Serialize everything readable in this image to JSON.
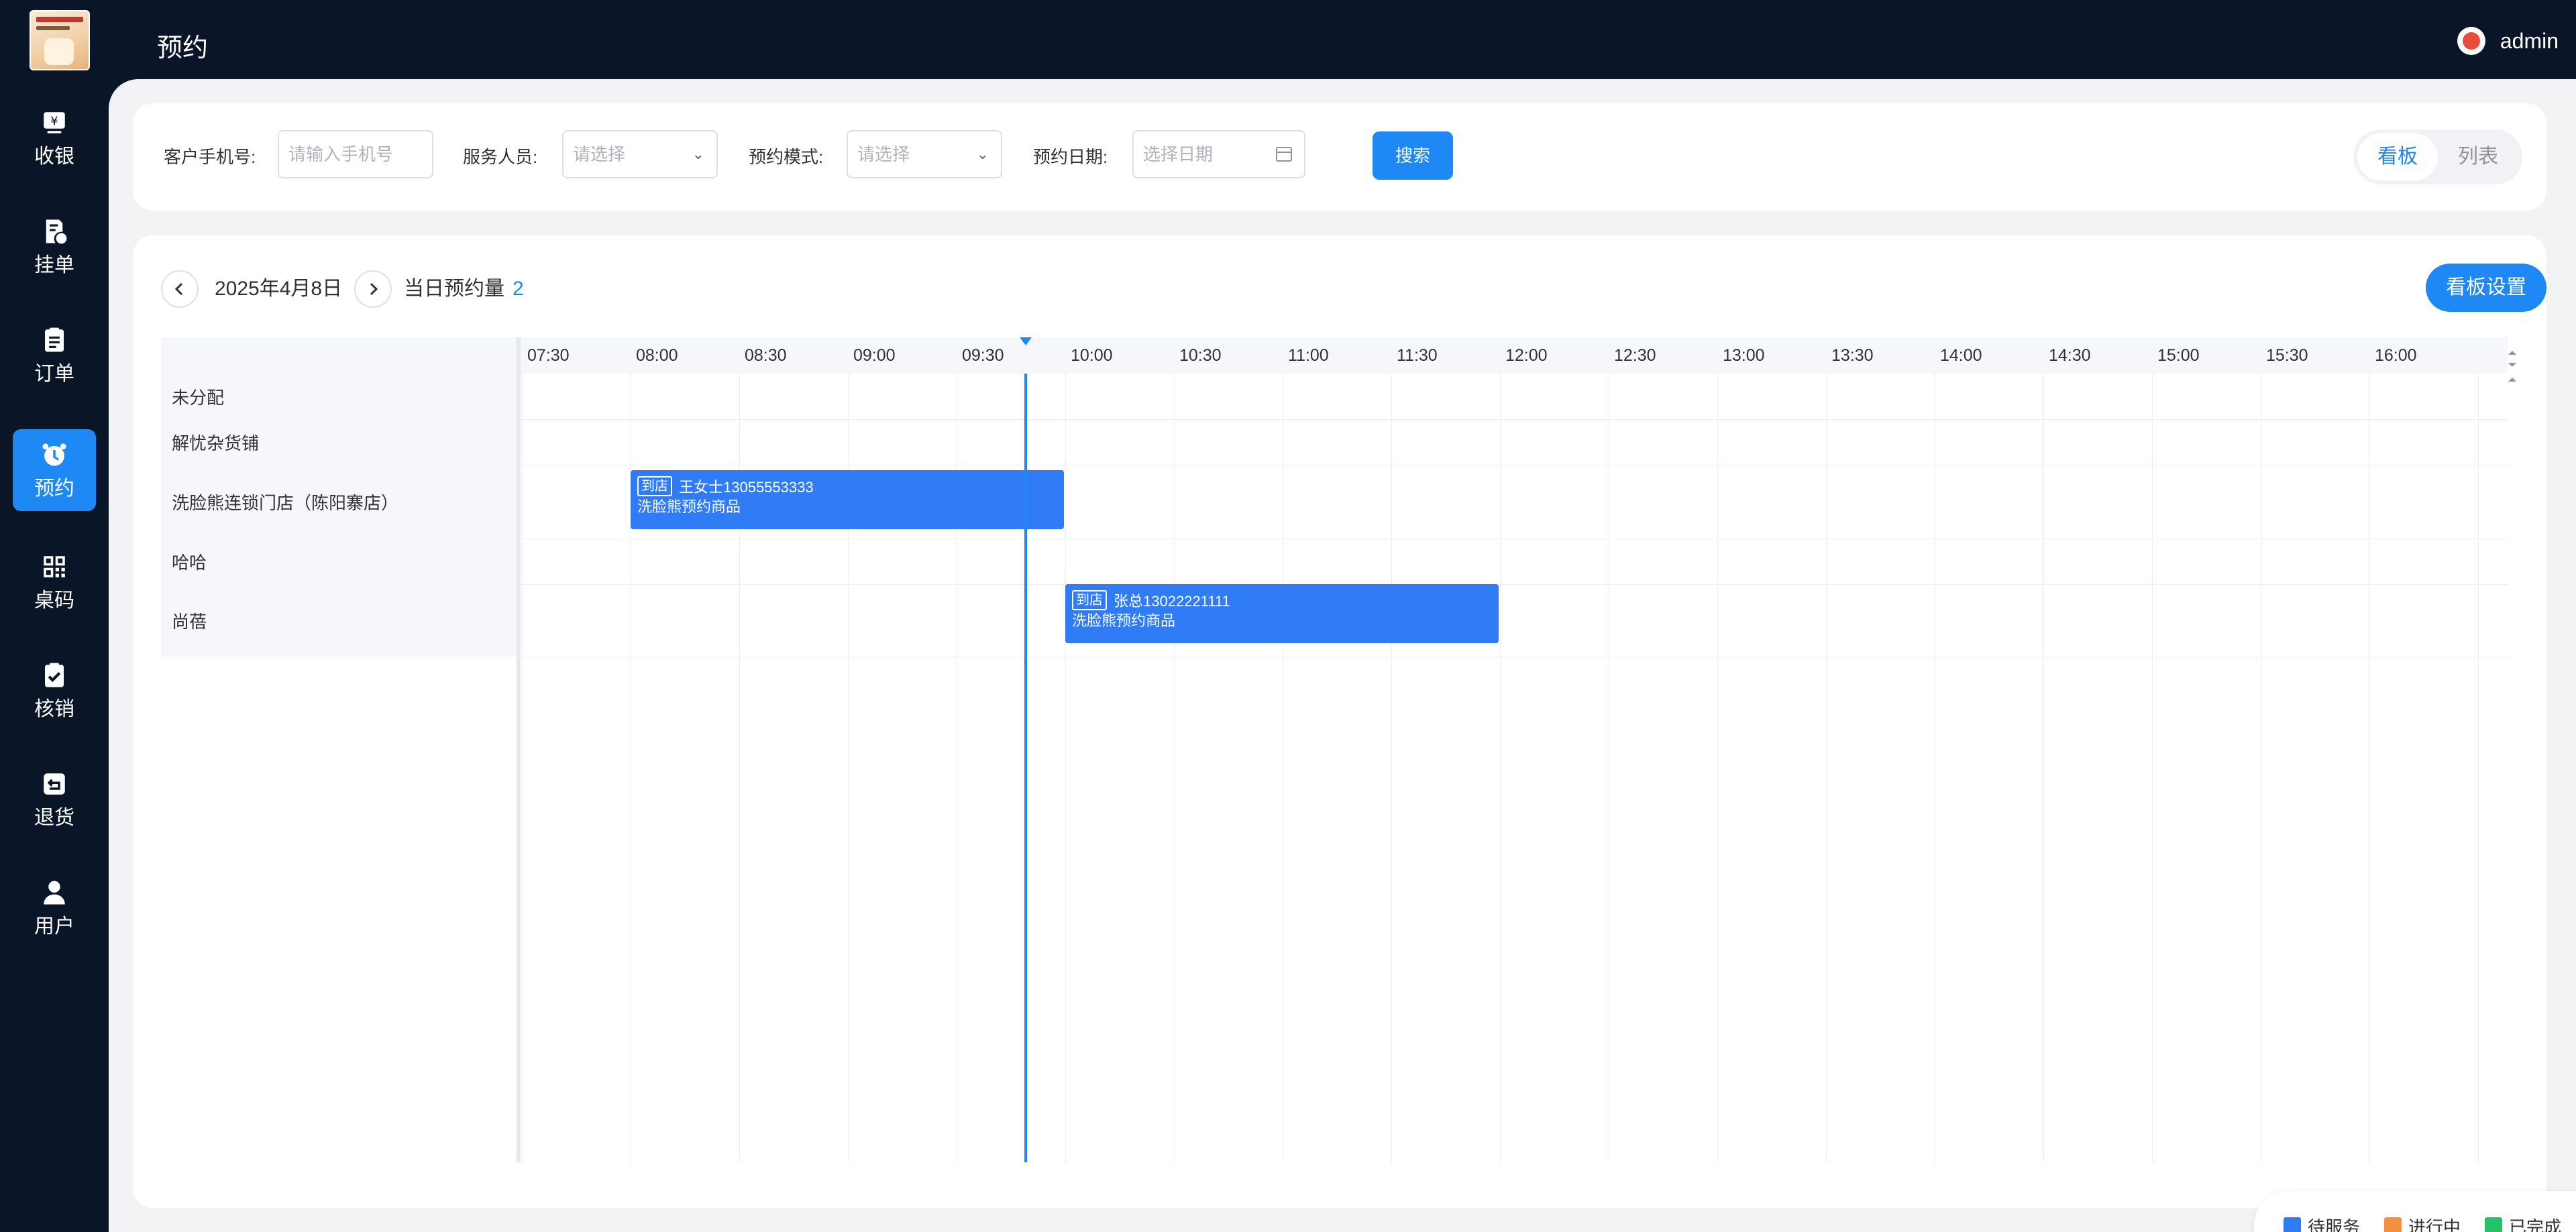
{
  "header": {
    "title": "预约",
    "user_name": "admin"
  },
  "sidebar": {
    "items": [
      {
        "label": "收银",
        "icon": "cashier-icon"
      },
      {
        "label": "挂单",
        "icon": "pending-order-icon"
      },
      {
        "label": "订单",
        "icon": "order-clipboard-icon"
      },
      {
        "label": "预约",
        "icon": "alarm-clock-icon",
        "active": true
      },
      {
        "label": "桌码",
        "icon": "qr-code-icon"
      },
      {
        "label": "核销",
        "icon": "check-clipboard-icon"
      },
      {
        "label": "退货",
        "icon": "return-icon"
      },
      {
        "label": "用户",
        "icon": "user-icon"
      }
    ]
  },
  "filters": {
    "phone_label": "客户手机号:",
    "phone_placeholder": "请输入手机号",
    "staff_label": "服务人员:",
    "staff_placeholder": "请选择",
    "mode_label": "预约模式:",
    "mode_placeholder": "请选择",
    "date_label": "预约日期:",
    "date_placeholder": "选择日期",
    "search_label": "搜索"
  },
  "view_toggle": {
    "board": "看板",
    "list": "列表",
    "active": "board"
  },
  "board": {
    "date": "2025年4月8日",
    "count_label": "当日预约量",
    "count_value": "2",
    "settings_label": "看板设置",
    "rows": [
      "未分配",
      "解忧杂货铺",
      "洗脸熊连锁门店（陈阳寨店）",
      "哈哈",
      "尚蓓"
    ],
    "time_ticks": [
      "07:30",
      "08:00",
      "08:30",
      "09:00",
      "09:30",
      "10:00",
      "10:30",
      "11:00",
      "11:30",
      "12:00",
      "12:30",
      "13:00",
      "13:30",
      "14:00",
      "14:30",
      "15:00",
      "15:30",
      "16:00"
    ],
    "current_time": "09:49",
    "appointments": [
      {
        "row": 2,
        "start": "08:00",
        "end": "10:00",
        "tag": "到店",
        "customer": "王女士13055553333",
        "service": "洗脸熊预约商品",
        "status": "pending"
      },
      {
        "row": 4,
        "start": "10:00",
        "end": "12:00",
        "tag": "到店",
        "customer": "张总13022221111",
        "service": "洗脸熊预约商品",
        "status": "pending"
      }
    ]
  },
  "legend": [
    {
      "label": "待服务",
      "color": "#2f7cf6"
    },
    {
      "label": "进行中",
      "color": "#f2913d"
    },
    {
      "label": "已完成",
      "color": "#27c16a"
    }
  ]
}
